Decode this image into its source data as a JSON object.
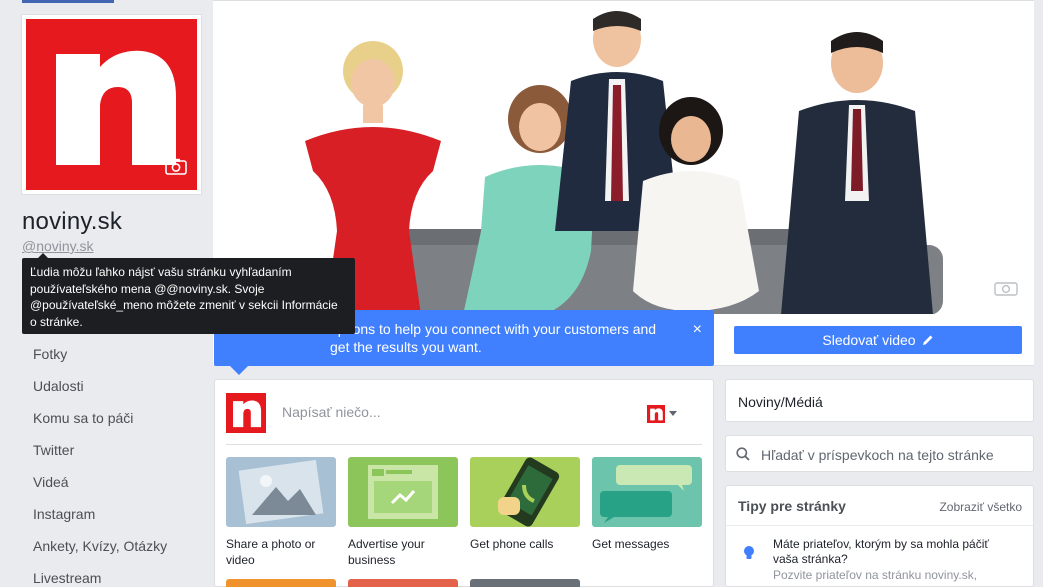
{
  "page": {
    "name": "noviny.sk",
    "handle": "@noviny.sk"
  },
  "tooltip": {
    "text": "Ľudia môžu ľahko nájsť vašu stránku vyhľadaním používateľského mena @@noviny.sk. Svoje @používateľské_meno môžete zmeniť v sekcii Informácie o stránke."
  },
  "nav": {
    "items": [
      {
        "label": "Fotky"
      },
      {
        "label": "Udalosti"
      },
      {
        "label": "Komu sa to páči"
      },
      {
        "label": "Twitter"
      },
      {
        "label": "Videá"
      },
      {
        "label": "Instagram"
      },
      {
        "label": "Ankety, Kvízy, Otázky"
      },
      {
        "label": "Livestream"
      }
    ]
  },
  "cover": {
    "follow_button": "Sledovať video"
  },
  "tip_banner": {
    "text": "Try new targeting options to help you connect with your customers and get the results you want.",
    "visible_text": "options to help you connect with your customers and get the results you want.",
    "close": "×"
  },
  "composer": {
    "placeholder": "Napísať niečo...",
    "actions": [
      {
        "label": "Share a photo or video",
        "icon": "photo-icon"
      },
      {
        "label": "Advertise your business",
        "icon": "advertise-icon"
      },
      {
        "label": "Get phone calls",
        "icon": "phone-icon"
      },
      {
        "label": "Get messages",
        "icon": "messages-icon"
      }
    ]
  },
  "sidebar": {
    "category": "Noviny/Médiá",
    "search_placeholder": "Hľadať v príspevkoch na tejto stránke",
    "tips_title": "Tipy pre stránky",
    "tips_link": "Zobraziť všetko",
    "tips_question": "Máte priateľov, ktorým by sa mohla páčiť vaša stránka?",
    "tips_sub": "Pozvite priateľov na stránku noviny.sk,"
  },
  "colors": {
    "brand_red": "#e5191e",
    "fb_blue": "#4080ff",
    "background": "#e9ebee"
  }
}
